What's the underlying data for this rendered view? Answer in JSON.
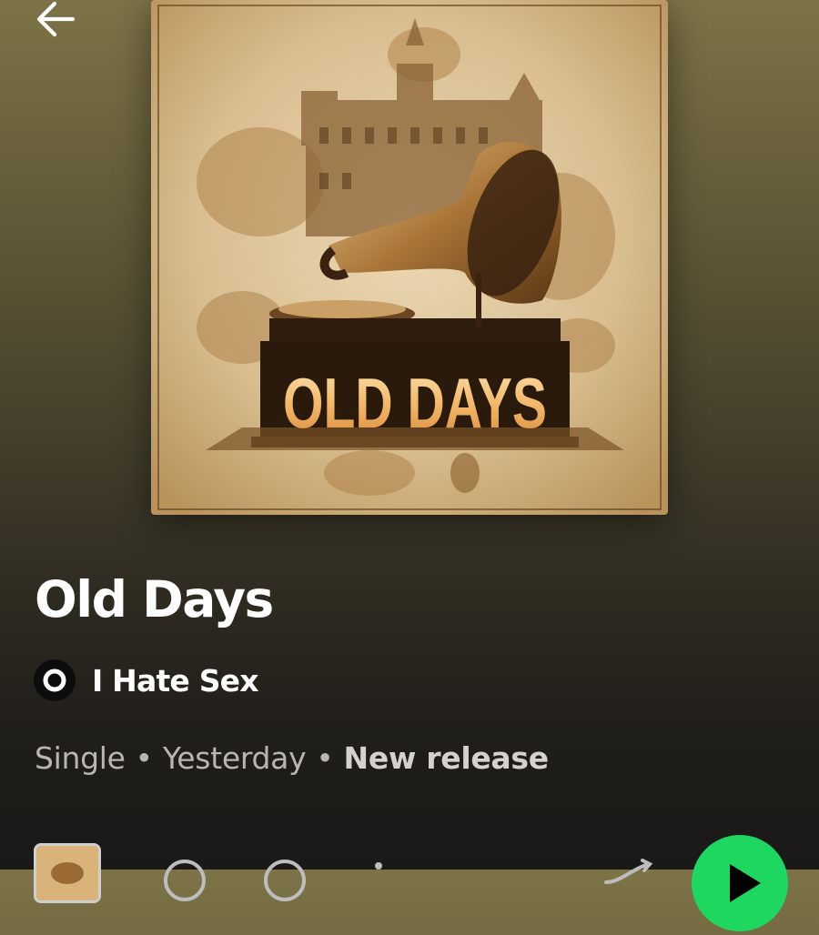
{
  "header": {
    "back_icon": "arrow-left-icon"
  },
  "album": {
    "cover_text": "OLD DAYS",
    "title": "Old Days",
    "artist": {
      "name": "I Hate Sex",
      "avatar_icon": "artist-avatar-ring"
    },
    "meta": {
      "type": "Single",
      "separator": "•",
      "date": "Yesterday",
      "badge": "New release"
    }
  },
  "controls": {
    "preview_icon": "preview-thumbnail",
    "save_icon": "add-circle-icon",
    "download_icon": "download-circle-icon",
    "more_icon": "more-dots-icon",
    "shuffle_icon": "shuffle-icon",
    "play_icon": "play-icon"
  },
  "colors": {
    "accent": "#1ed760",
    "background_top": "#7d7347",
    "background_bottom": "#1a1917",
    "text_primary": "#ffffff",
    "text_secondary": "#b8b6ad"
  }
}
